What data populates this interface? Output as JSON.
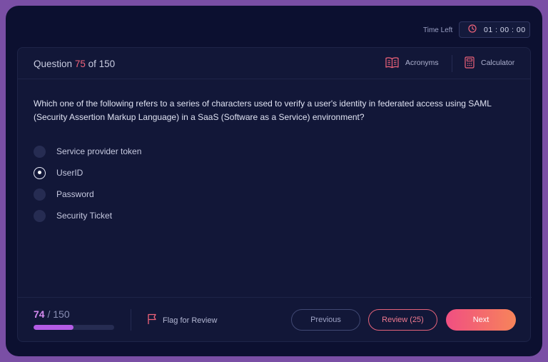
{
  "timer": {
    "label": "Time Left",
    "value": "01 : 00 : 00"
  },
  "header": {
    "question_prefix": "Question",
    "question_number": "75",
    "question_suffix": "of 150",
    "acronyms_label": "Acronyms",
    "calculator_label": "Calculator"
  },
  "question": {
    "text": "Which one of the following refers to a series of characters used to verify a user's identity in federated access using SAML (Security Assertion Markup Language) in a SaaS (Software as a Service) environment?",
    "options": [
      {
        "label": "Service provider token",
        "selected": false
      },
      {
        "label": "UserID",
        "selected": true
      },
      {
        "label": "Password",
        "selected": false
      },
      {
        "label": "Security Ticket",
        "selected": false
      }
    ]
  },
  "footer": {
    "progress_current": "74",
    "progress_total": "/ 150",
    "progress_fraction": 0.4933,
    "flag_label": "Flag for Review",
    "previous_label": "Previous",
    "review_label": "Review (25)",
    "next_label": "Next"
  },
  "colors": {
    "accent_pink": "#f0637a",
    "progress_purple": "#b45ce6",
    "next_gradient_start": "#f04f82",
    "next_gradient_end": "#f7845a"
  },
  "icons": {
    "timer": "clock-icon",
    "acronyms": "book-icon",
    "calculator": "calculator-icon",
    "flag": "flag-icon"
  }
}
